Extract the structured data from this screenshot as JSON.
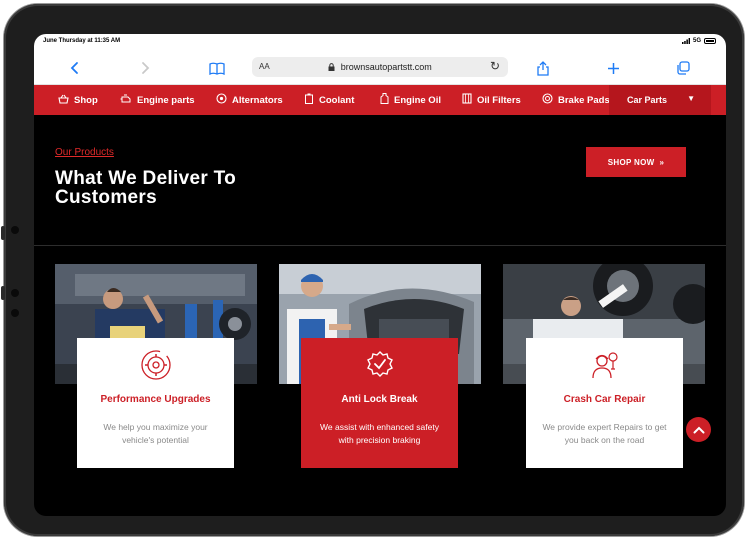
{
  "status_bar": {
    "time": "June Thursday at 11:35 AM",
    "network": "5G"
  },
  "browser": {
    "url": "brownsautopartstt.com",
    "text_size": "AA"
  },
  "nav": {
    "items": [
      {
        "label": "Shop",
        "icon": "basket-icon"
      },
      {
        "label": "Engine parts",
        "icon": "engine-icon"
      },
      {
        "label": "Alternators",
        "icon": "alternator-icon"
      },
      {
        "label": "Coolant",
        "icon": "coolant-icon"
      },
      {
        "label": "Engine Oil",
        "icon": "oil-bottle-icon"
      },
      {
        "label": "Oil Filters",
        "icon": "filter-icon"
      },
      {
        "label": "Brake Pads",
        "icon": "brake-icon"
      }
    ],
    "dropdown_label": "Car Parts"
  },
  "hero": {
    "kicker": "Our Products",
    "heading": "What We Deliver To Customers",
    "shop_button": "SHOP NOW"
  },
  "services": [
    {
      "title": "Performance Upgrades",
      "description": "We help you maximize your vehicle's potential",
      "icon": "gear-settings-icon"
    },
    {
      "title": "Anti Lock Break",
      "description": "We assist with enhanced safety with precision braking",
      "icon": "badge-check-icon"
    },
    {
      "title": "Crash Car Repair",
      "description": "We provide expert Repairs to get you back on the road",
      "icon": "mechanic-icon"
    }
  ],
  "colors": {
    "accent": "#cc1f26",
    "background": "#000000"
  }
}
